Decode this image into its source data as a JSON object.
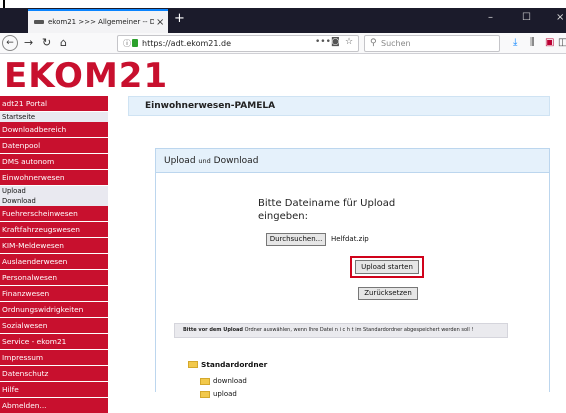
{
  "browser": {
    "tab_title": "ekom21 >>> Allgemeiner -- D...",
    "tab_close": "×",
    "new_tab": "+",
    "window_controls": [
      "–",
      "☐",
      "×"
    ],
    "url": "https://adt.ekom21.de",
    "search_placeholder": "Suchen",
    "nav_icons": [
      "back-icon",
      "forward-icon",
      "reload-icon",
      "home-icon"
    ],
    "url_icons": [
      "page-actions-icon",
      "pocket-icon",
      "bookmark-star-icon"
    ],
    "toolbar_icons": [
      "download-icon",
      "library-icon",
      "addon-icon",
      "sidebar-icon"
    ]
  },
  "brand": {
    "logo": "EKOM21",
    "accent": "#c8102e"
  },
  "sidebar": {
    "items": [
      {
        "label": "adt21 Portal",
        "style": "red"
      },
      {
        "label": "Startseite",
        "style": "plain"
      },
      {
        "label": "Downloadbereich",
        "style": "red"
      },
      {
        "label": "Datenpool",
        "style": "red"
      },
      {
        "label": "DMS autonom",
        "style": "red"
      },
      {
        "label": "Einwohnerwesen",
        "style": "red"
      },
      {
        "label": "Upload\nDownload",
        "style": "plain"
      },
      {
        "label": "Fuehrerscheinwesen",
        "style": "red"
      },
      {
        "label": "Kraftfahrzeugswesen",
        "style": "red"
      },
      {
        "label": "KIM-Meldewesen",
        "style": "red"
      },
      {
        "label": "Auslaenderwesen",
        "style": "red"
      },
      {
        "label": "Personalwesen",
        "style": "red"
      },
      {
        "label": "Finanzwesen",
        "style": "red"
      },
      {
        "label": "Ordnungswidrigkeiten",
        "style": "red"
      },
      {
        "label": "Sozialwesen",
        "style": "red"
      },
      {
        "label": "Service - ekom21",
        "style": "red"
      },
      {
        "label": "Impressum",
        "style": "red"
      },
      {
        "label": "Datenschutz",
        "style": "red"
      },
      {
        "label": "Hilfe",
        "style": "red"
      },
      {
        "label": "Abmelden...",
        "style": "red"
      }
    ]
  },
  "page": {
    "title": "Einwohnerwesen-PAMELA"
  },
  "panel": {
    "title_a": "Upload",
    "title_small": "und",
    "title_b": "Download",
    "prompt": "Bitte Dateiname für Upload eingeben:",
    "browse_label": "Durchsuchen...",
    "file_name": "Helfdat.zip",
    "upload_label": "Upload starten",
    "reset_label": "Zurücksetzen",
    "hint_bold": "Bitte vor dem Upload",
    "hint_rest": " Ordner auswählen, wenn Ihre Datei  n i c h t  im Standardordner abgespeichert werden soll !",
    "tree_root": "Standardordner",
    "tree_children": [
      "download",
      "upload"
    ]
  }
}
